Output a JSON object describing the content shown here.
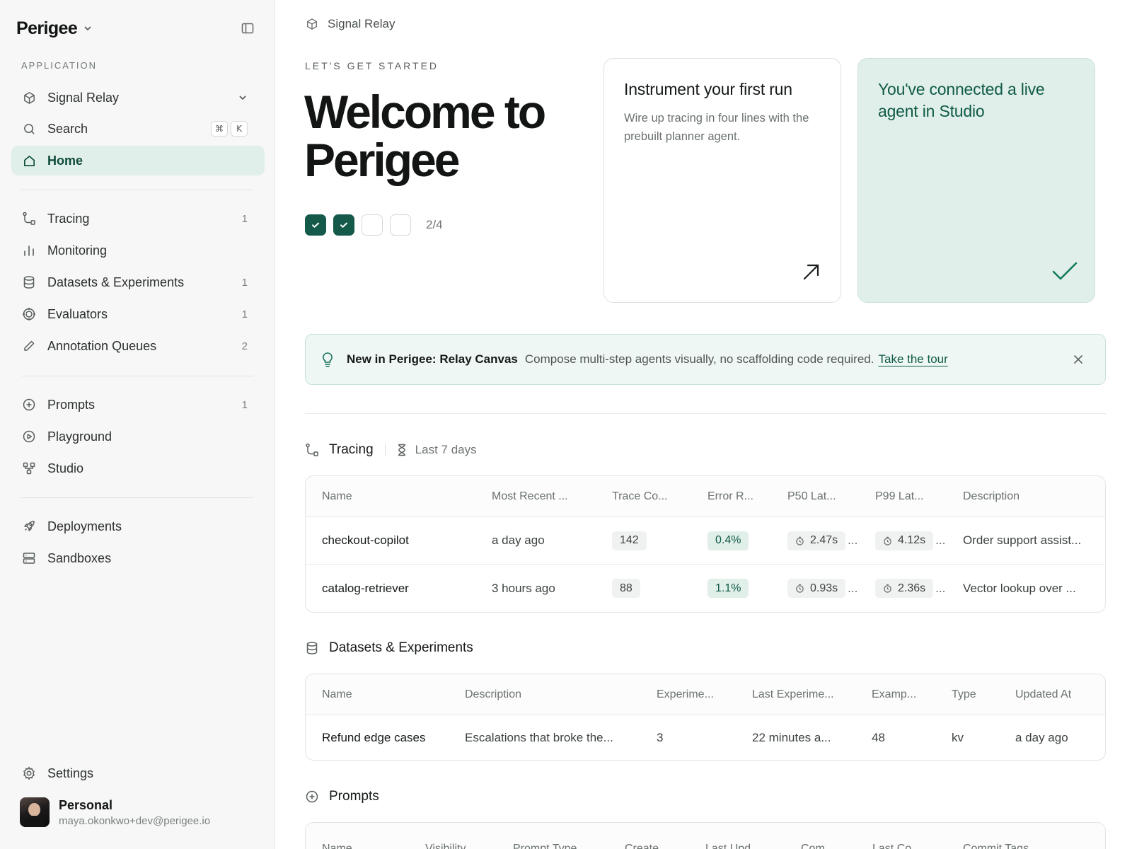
{
  "sidebar": {
    "brand": "Perigee",
    "section_label": "APPLICATION",
    "app_selector": "Signal Relay",
    "search": {
      "label": "Search",
      "kbd_cmd": "⌘",
      "kbd_key": "K"
    },
    "home": "Home",
    "group1": [
      {
        "label": "Tracing",
        "count": "1",
        "icon": "tracing-icon"
      },
      {
        "label": "Monitoring",
        "count": "",
        "icon": "bar-chart-icon"
      },
      {
        "label": "Datasets & Experiments",
        "count": "1",
        "icon": "database-icon"
      },
      {
        "label": "Evaluators",
        "count": "1",
        "icon": "target-icon"
      },
      {
        "label": "Annotation Queues",
        "count": "2",
        "icon": "pencil-icon"
      }
    ],
    "group2": [
      {
        "label": "Prompts",
        "count": "1",
        "icon": "plus-circle-icon"
      },
      {
        "label": "Playground",
        "count": "",
        "icon": "play-circle-icon"
      },
      {
        "label": "Studio",
        "count": "",
        "icon": "nodes-icon"
      }
    ],
    "group3": [
      {
        "label": "Deployments",
        "icon": "rocket-icon"
      },
      {
        "label": "Sandboxes",
        "icon": "server-icon"
      }
    ],
    "settings": "Settings",
    "profile": {
      "name": "Personal",
      "email": "maya.okonkwo+dev@perigee.io"
    }
  },
  "main": {
    "breadcrumb": "Signal Relay",
    "eyebrow": "LET'S GET STARTED",
    "hero_title": "Welcome to Perigee",
    "steps": {
      "completed": 2,
      "total": 4,
      "label": "2/4"
    },
    "card1": {
      "title": "Instrument your first run",
      "subtitle": "Wire up tracing in four lines with the prebuilt planner agent."
    },
    "card2": {
      "title": "You've connected a live agent in Studio"
    },
    "banner": {
      "strong": "New in Perigee: Relay Canvas",
      "text": "Compose multi-step agents visually, no scaffolding code required.",
      "link": "Take the tour"
    },
    "tracing": {
      "title": "Tracing",
      "range": "Last 7 days",
      "columns": [
        "Name",
        "Most Recent ...",
        "Trace Co...",
        "Error R...",
        "P50 Lat...",
        "P99 Lat...",
        "Description"
      ],
      "rows": [
        {
          "name": "checkout-copilot",
          "recent": "a day ago",
          "count": "142",
          "error": "0.4%",
          "p50": "2.47s",
          "p99": "4.12s",
          "desc": "Order support assist..."
        },
        {
          "name": "catalog-retriever",
          "recent": "3 hours ago",
          "count": "88",
          "error": "1.1%",
          "p50": "0.93s",
          "p99": "2.36s",
          "desc": "Vector lookup over ..."
        }
      ]
    },
    "datasets": {
      "title": "Datasets & Experiments",
      "columns": [
        "Name",
        "Description",
        "Experime...",
        "Last Experime...",
        "Examp...",
        "Type",
        "Updated At"
      ],
      "rows": [
        {
          "name": "Refund edge cases",
          "desc": "Escalations that broke the...",
          "experiments": "3",
          "last": "22 minutes a...",
          "examples": "48",
          "type": "kv",
          "updated": "a day ago"
        }
      ]
    },
    "prompts": {
      "title": "Prompts",
      "columns": [
        "Name",
        "Visibility",
        "Prompt Type",
        "Create...",
        "Last Upd...",
        "Com...",
        "Last Co...",
        "Commit Tags"
      ]
    }
  },
  "colors": {
    "accent": "#15594a",
    "accent_soft": "#e0efe9",
    "text": "#1c1f1e"
  }
}
